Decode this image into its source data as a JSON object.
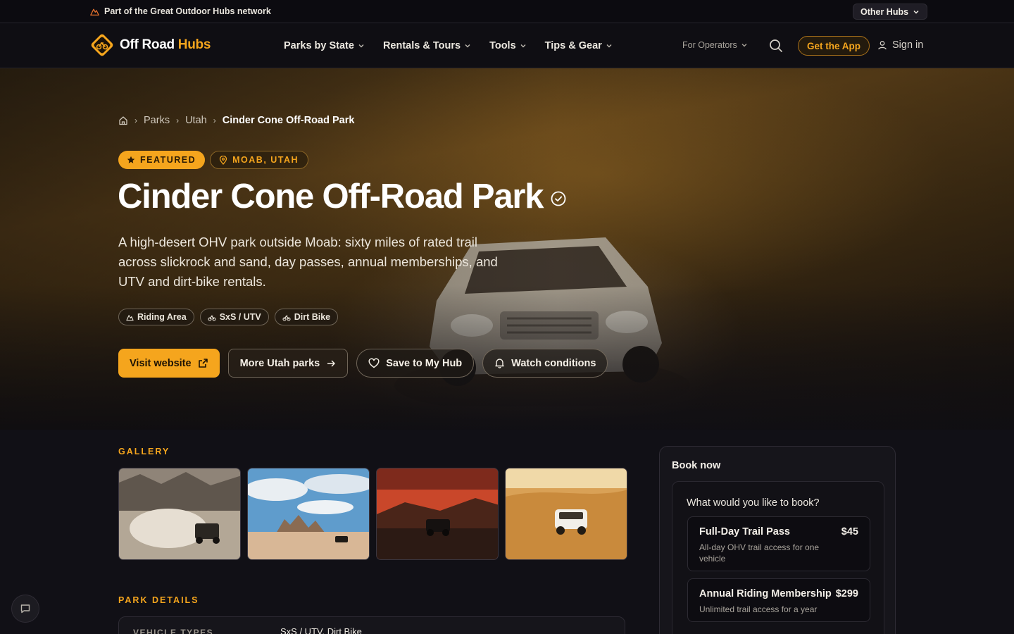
{
  "topbar": {
    "network_text": "Part of the Great Outdoor Hubs network",
    "other_hubs_label": "Other Hubs"
  },
  "nav": {
    "logo_part1": "Off Road",
    "logo_part2": "Hubs",
    "items": [
      {
        "label": "Parks by State"
      },
      {
        "label": "Rentals & Tours"
      },
      {
        "label": "Tools"
      },
      {
        "label": "Tips & Gear"
      }
    ],
    "operators_label": "For Operators",
    "app_button": "Get the App",
    "signin_label": "Sign in"
  },
  "breadcrumb": {
    "items": [
      "Parks",
      "Utah"
    ],
    "current": "Cinder Cone Off-Road Park"
  },
  "badges": {
    "featured": "FEATURED",
    "location": "MOAB, UTAH"
  },
  "park": {
    "title": "Cinder Cone Off-Road Park",
    "description": "A high-desert OHV park outside Moab: sixty miles of rated trail across slickrock and sand, day passes, annual memberships, and UTV and dirt-bike rentals.",
    "chips": [
      "Riding Area",
      "SxS / UTV",
      "Dirt Bike"
    ]
  },
  "actions": {
    "visit": "Visit website",
    "more_parks": "More Utah parks",
    "save": "Save to My Hub",
    "watch": "Watch conditions"
  },
  "gallery": {
    "label": "GALLERY"
  },
  "details": {
    "label": "PARK DETAILS",
    "rows": [
      {
        "key": "VEHICLE TYPES",
        "value": "SxS / UTV, Dirt Bike"
      }
    ]
  },
  "booking": {
    "title": "Book now",
    "question": "What would you like to book?",
    "options": [
      {
        "name": "Full-Day Trail Pass",
        "price": "$45",
        "description": "All-day OHV trail access for one vehicle"
      },
      {
        "name": "Annual Riding Membership",
        "price": "$299",
        "description": "Unlimited trail access for a year"
      }
    ]
  },
  "colors": {
    "accent": "#f5a51d",
    "background": "#111016",
    "panel": "#16151b"
  },
  "icons": [
    "mountain-icon",
    "chevron-down-icon",
    "search-icon",
    "user-icon",
    "home-icon",
    "star-icon",
    "pin-icon",
    "verified-icon",
    "external-link-icon",
    "arrow-right-icon",
    "heart-icon",
    "bell-icon",
    "chat-icon"
  ]
}
